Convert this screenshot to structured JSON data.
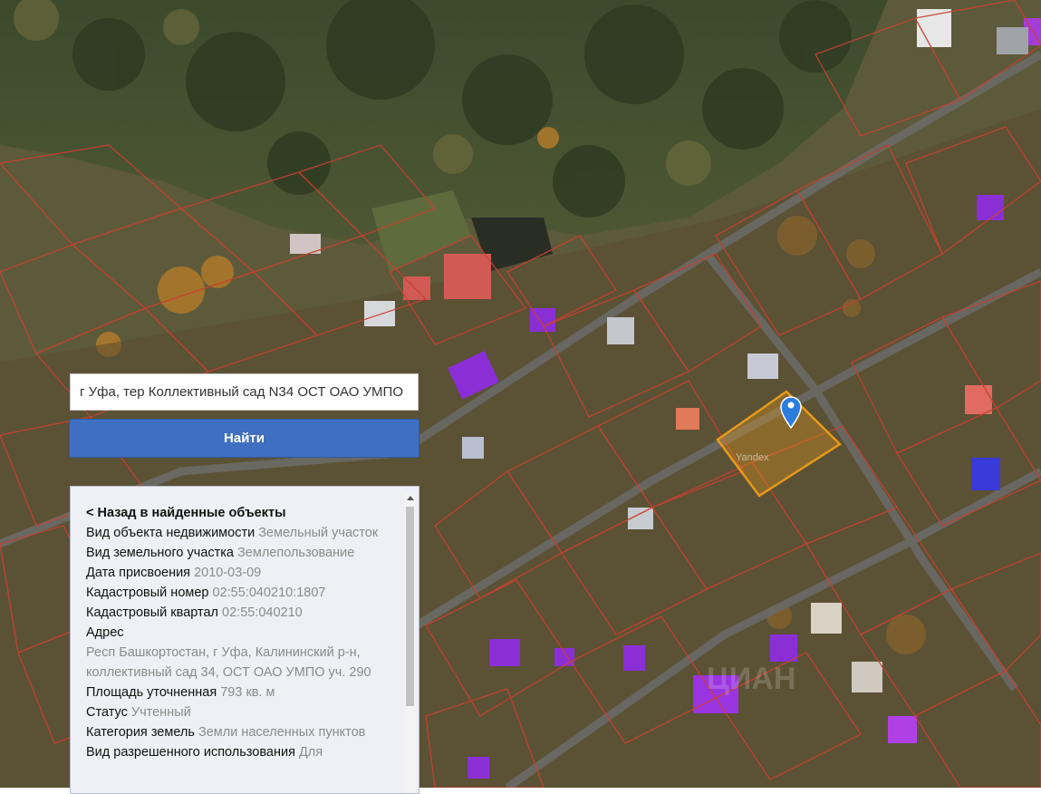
{
  "map": {
    "watermark": "Yandex",
    "photo_watermark": "ЦИАН"
  },
  "search": {
    "value": "г Уфа, тер Коллективный сад N34 ОСТ ОАО УМПО",
    "button_label": "Найти"
  },
  "info": {
    "back_link": "< Назад в найденные объекты",
    "object_type_label": "Вид объекта недвижимости",
    "object_type_value": "Земельный участок",
    "land_type_label": "Вид земельного участка",
    "land_type_value": "Землепользование",
    "date_label": "Дата присвоения",
    "date_value": "2010-03-09",
    "cad_number_label": "Кадастровый номер",
    "cad_number_value": "02:55:040210:1807",
    "cad_quarter_label": "Кадастровый квартал",
    "cad_quarter_value": "02:55:040210",
    "address_label": "Адрес",
    "address_value": "Респ Башкортостан, г Уфа, Калининский р-н, коллективный сад 34, ОСТ ОАО УМПО уч. 290",
    "area_label": "Площадь уточненная",
    "area_value": "793 кв. м",
    "status_label": "Статус",
    "status_value": "Учтенный",
    "category_label": "Категория земель",
    "category_value": "Земли населенных пунктов",
    "permitted_use_label": "Вид разрешенного использования",
    "permitted_use_value": "Для"
  }
}
